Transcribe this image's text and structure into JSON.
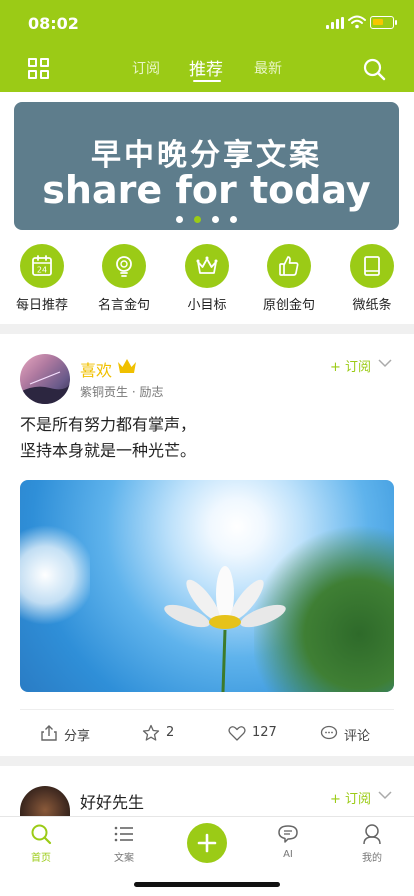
{
  "status_bar": {
    "time": "08:02"
  },
  "nav": {
    "tabs": [
      {
        "label": "订阅",
        "active": false
      },
      {
        "label": "推荐",
        "active": true
      },
      {
        "label": "最新",
        "active": false
      }
    ]
  },
  "banner": {
    "title_cn": "早中晚分享文案",
    "title_en": "share for today",
    "page_count": 4,
    "active_page": 2
  },
  "categories": [
    {
      "label": "每日推荐",
      "icon": "calendar-icon",
      "badge": "24"
    },
    {
      "label": "名言金句",
      "icon": "lightbulb-icon"
    },
    {
      "label": "小目标",
      "icon": "crown-icon"
    },
    {
      "label": "原创金句",
      "icon": "thumbs-up-icon"
    },
    {
      "label": "微纸条",
      "icon": "book-icon"
    }
  ],
  "post": {
    "author": "喜欢",
    "subtitle": "紫铜贡生 · 励志",
    "subscribe_label": "+ 订阅",
    "text_line1": "不是所有努力都有掌声，",
    "text_line2": "坚持本身就是一种光芒。",
    "actions": {
      "share_label": "分享",
      "star_count": "2",
      "like_count": "127",
      "comment_label": "评论"
    }
  },
  "post2": {
    "author": "好好先生",
    "subscribe_label": "+ 订阅"
  },
  "tabbar": {
    "items": [
      {
        "label": "首页",
        "icon": "search-home-icon",
        "active": true
      },
      {
        "label": "文案",
        "icon": "list-icon",
        "active": false
      },
      {
        "label": "AI",
        "icon": "chat-bubble-icon",
        "active": false
      },
      {
        "label": "我的",
        "icon": "profile-icon",
        "active": false
      }
    ]
  },
  "colors": {
    "brand_green": "#9bcb16",
    "author_gold": "#f0c000",
    "banner_bg": "#5e7d8c"
  }
}
